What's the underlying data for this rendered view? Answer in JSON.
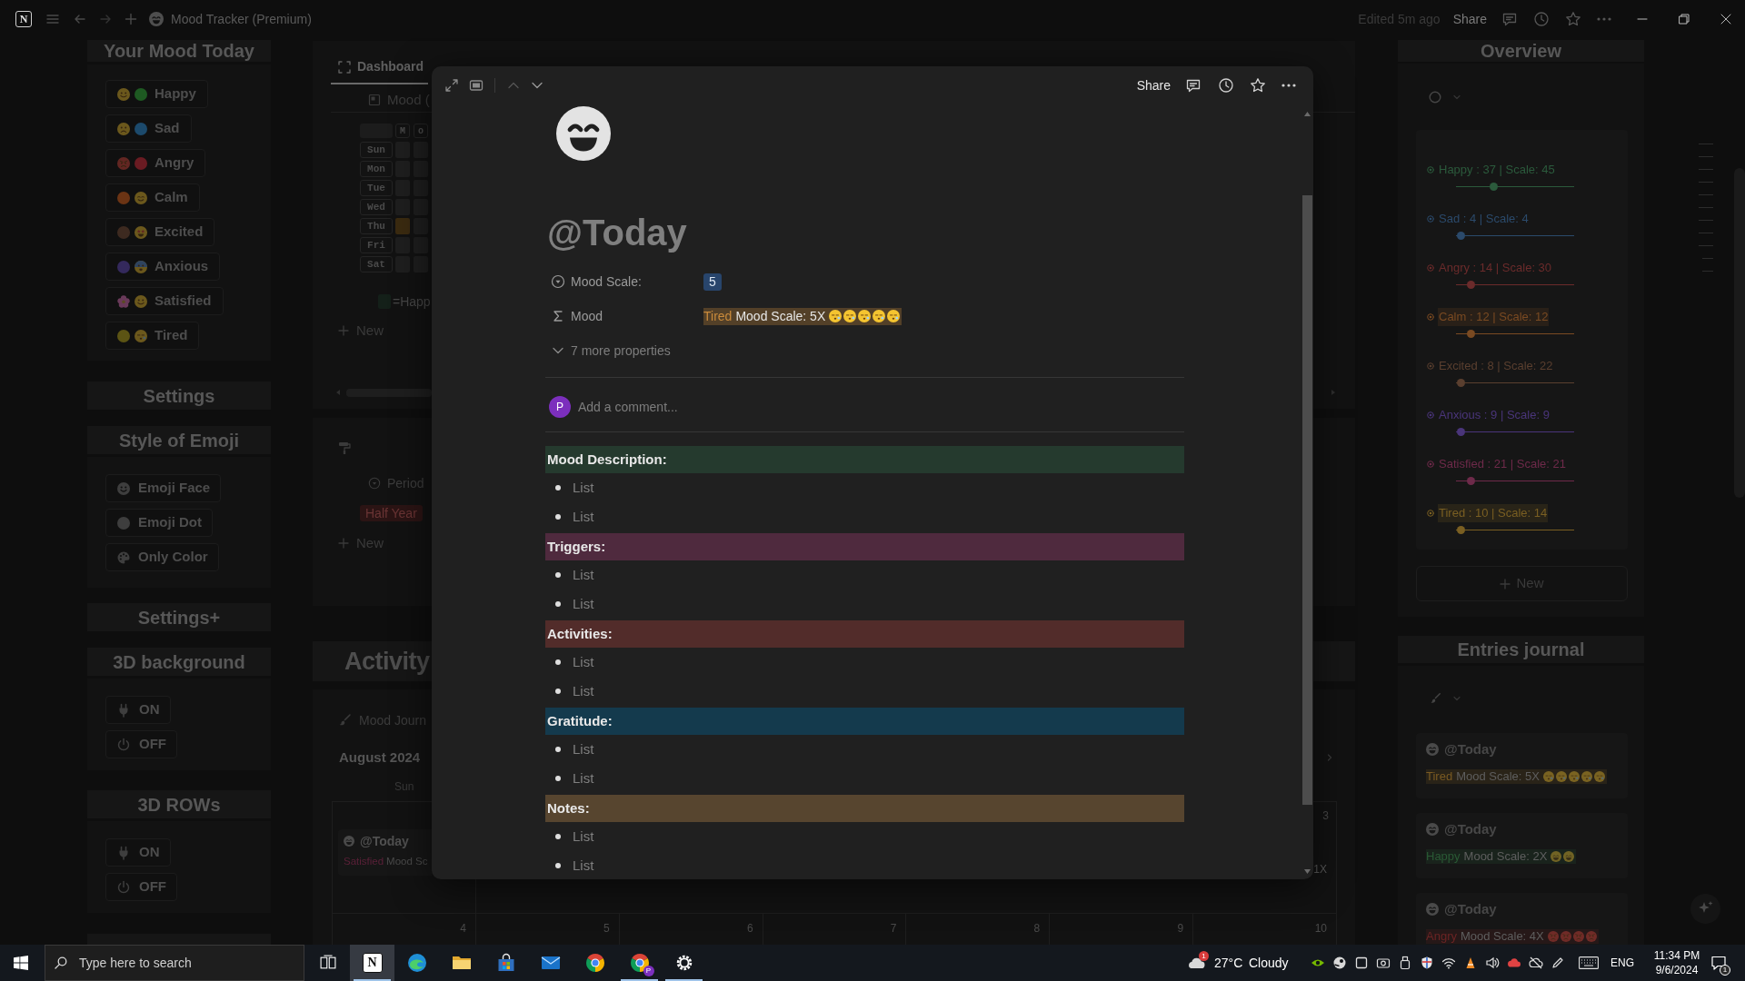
{
  "title_bar": {
    "logo": "N",
    "title": "Mood Tracker (Premium)",
    "edited": "Edited 5m ago",
    "share": "Share"
  },
  "left_panel": {
    "mood_title": "Your Mood Today",
    "moods": [
      {
        "label": "Happy",
        "icons": [
          {
            "kind": "smile"
          },
          {
            "kind": "dot",
            "color": "#1e5a22"
          }
        ]
      },
      {
        "label": "Sad",
        "icons": [
          {
            "kind": "frown"
          },
          {
            "kind": "dot",
            "color": "#1c4a6c"
          }
        ]
      },
      {
        "label": "Angry",
        "icons": [
          {
            "kind": "angry"
          },
          {
            "kind": "dot",
            "color": "#6a1b22"
          }
        ]
      },
      {
        "label": "Calm",
        "icons": [
          {
            "kind": "dot",
            "color": "#6b3414"
          },
          {
            "kind": "relieved"
          }
        ]
      },
      {
        "label": "Excited",
        "icons": [
          {
            "kind": "dot",
            "color": "#3d2a20"
          },
          {
            "kind": "starstruck"
          }
        ]
      },
      {
        "label": "Anxious",
        "icons": [
          {
            "kind": "dot",
            "color": "#34295c"
          },
          {
            "kind": "anxious"
          }
        ]
      },
      {
        "label": "Satisfied",
        "icons": [
          {
            "kind": "flower",
            "color": "#6a3a5a"
          },
          {
            "kind": "smile"
          }
        ]
      },
      {
        "label": "Tired",
        "icons": [
          {
            "kind": "dot",
            "color": "#5c5414"
          },
          {
            "kind": "sleepy"
          }
        ]
      }
    ],
    "settings_title": "Settings",
    "emoji_style_title": "Style of Emoji",
    "emoji_styles": [
      {
        "label": "Emoji Face",
        "kind": "face"
      },
      {
        "label": "Emoji Dot",
        "kind": "dot"
      },
      {
        "label": "Only Color",
        "kind": "palette"
      }
    ],
    "settings_plus_title": "Settings+",
    "toggle_groups": [
      {
        "title": "3D background",
        "buttons": [
          {
            "label": "ON",
            "kind": "plug"
          },
          {
            "label": "OFF",
            "kind": "power"
          }
        ]
      },
      {
        "title": "3D ROWs",
        "buttons": [
          {
            "label": "ON",
            "kind": "plug"
          },
          {
            "label": "OFF",
            "kind": "power"
          }
        ]
      }
    ]
  },
  "dashboard": {
    "tabs": [
      {
        "label": "Dashboard",
        "selected": true
      }
    ],
    "view": "Mood (",
    "heatmap": {
      "columns": [
        "M",
        "o"
      ],
      "days": [
        {
          "label": "Sun",
          "cells": [
            {
              "filled": false
            },
            {
              "filled": false
            }
          ]
        },
        {
          "label": "Mon",
          "cells": [
            {
              "filled": false
            },
            {
              "filled": false
            }
          ]
        },
        {
          "label": "Tue",
          "cells": [
            {
              "filled": false
            },
            {
              "filled": false
            }
          ]
        },
        {
          "label": "Wed",
          "cells": [
            {
              "filled": false
            },
            {
              "filled": false
            }
          ]
        },
        {
          "label": "Thu",
          "cells": [
            {
              "filled": true
            },
            {
              "filled": false
            }
          ]
        },
        {
          "label": "Fri",
          "cells": [
            {
              "filled": false
            },
            {
              "filled": false
            }
          ]
        },
        {
          "label": "Sat",
          "cells": [
            {
              "filled": false
            },
            {
              "filled": false
            }
          ]
        }
      ]
    },
    "legend": "=Happ",
    "new_label": "New"
  },
  "period": {
    "label": "Period",
    "tag": "Half Year",
    "new_label": "New"
  },
  "activity": {
    "title": "Activity",
    "view": "Mood Journ",
    "month": "August 2024",
    "weekday": "Sun",
    "week_1": {
      "sun_entry": {
        "title": "@Today",
        "mood": "Satisfied",
        "color": "#5a2038",
        "text": "Mood Sc"
      },
      "sat_date": "3",
      "sat_entry_text": "1X"
    },
    "week_2_dates": [
      "4",
      "5",
      "6",
      "7",
      "8",
      "9",
      "10"
    ]
  },
  "peek": {
    "share": "Share",
    "title": "@Today",
    "properties": [
      {
        "kind": "select",
        "label": "Mood Scale:",
        "value": "5"
      },
      {
        "kind": "formula",
        "label": "Mood",
        "mood": "Tired",
        "text": "Mood Scale: 5X",
        "faces": [
          {
            "kind": "sleepy"
          },
          {
            "kind": "sleepy"
          },
          {
            "kind": "sleepy"
          },
          {
            "kind": "sleepy"
          },
          {
            "kind": "sleepy"
          }
        ]
      }
    ],
    "more_properties": "7 more properties",
    "comment": {
      "avatar": "P",
      "placeholder": "Add a comment..."
    },
    "sections": [
      {
        "heading": "Mood Description:",
        "color": "#253a2e",
        "items": [
          "List",
          "List"
        ]
      },
      {
        "heading": "Triggers:",
        "color": "#4f2a3e",
        "items": [
          "List",
          "List"
        ]
      },
      {
        "heading": "Activities:",
        "color": "#522c2a",
        "items": [
          "List",
          "List"
        ]
      },
      {
        "heading": "Gratitude:",
        "color": "#143a4d",
        "items": [
          "List",
          "List"
        ]
      },
      {
        "heading": "Notes:",
        "color": "#57452f",
        "items": [
          "List",
          "List"
        ]
      }
    ]
  },
  "overview": {
    "title": "Overview",
    "items": [
      {
        "label": "Happy : 37 | Scale: 45",
        "color": "#2b5a3c",
        "highlighted": false,
        "level": 0.32
      },
      {
        "label": "Sad : 4 | Scale: 4",
        "color": "#2b4a6b",
        "highlighted": false,
        "level": 0.04
      },
      {
        "label": "Angry : 14 | Scale: 30",
        "color": "#6b2b2b",
        "highlighted": false,
        "level": 0.13
      },
      {
        "label": "Calm : 12 | Scale: 12",
        "color": "#7a4a22",
        "highlighted": true,
        "level": 0.13
      },
      {
        "label": "Excited : 8 | Scale: 22",
        "color": "#5a3f2f",
        "highlighted": false,
        "level": 0.04
      },
      {
        "label": "Anxious : 9 | Scale: 9",
        "color": "#4a357a",
        "highlighted": false,
        "level": 0.04
      },
      {
        "label": "Satisfied : 21 | Scale: 21",
        "color": "#6e2a4a",
        "highlighted": false,
        "level": 0.13
      },
      {
        "label": "Tired : 10 | Scale: 14",
        "color": "#7a5f22",
        "highlighted": true,
        "level": 0.04
      }
    ],
    "new_label": "New"
  },
  "entries_journal": {
    "title": "Entries journal",
    "entries": [
      {
        "title": "@Today",
        "mood": "Tired",
        "color": "#7a5a22",
        "text": "Mood Scale: 5X",
        "faces": [
          {
            "kind": "sleepy"
          },
          {
            "kind": "sleepy"
          },
          {
            "kind": "sleepy"
          },
          {
            "kind": "sleepy"
          },
          {
            "kind": "sleepy"
          }
        ]
      },
      {
        "title": "@Today",
        "mood": "Happy",
        "color": "#2a5a35",
        "text": "Mood Scale: 2X",
        "faces": [
          {
            "kind": "grin"
          },
          {
            "kind": "grin"
          }
        ]
      },
      {
        "title": "@Today",
        "mood": "Angry",
        "color": "#6b2424",
        "text": "Mood Scale: 4X",
        "faces": [
          {
            "kind": "angry"
          },
          {
            "kind": "angry"
          },
          {
            "kind": "angry"
          },
          {
            "kind": "angry"
          }
        ]
      }
    ]
  },
  "taskbar": {
    "search": {
      "placeholder": "Type here to search"
    },
    "apps": [
      {
        "kind": "task-view",
        "active": false,
        "running": false
      },
      {
        "kind": "n-tile",
        "label": "N",
        "active": true,
        "running": true
      },
      {
        "kind": "swirl",
        "active": false,
        "running": false
      },
      {
        "kind": "folder",
        "active": false,
        "running": false
      },
      {
        "kind": "bag",
        "active": false,
        "running": false
      },
      {
        "kind": "envelope",
        "active": false,
        "running": false
      },
      {
        "kind": "segmented-circle",
        "active": false,
        "running": false
      },
      {
        "kind": "segmented-circle-badge",
        "label": "P",
        "active": false,
        "running": true
      },
      {
        "kind": "gear",
        "active": false,
        "running": true
      }
    ],
    "weather": {
      "badge": "1",
      "temperature": "27°C",
      "condition": "Cloudy"
    },
    "language": "ENG",
    "time": "11:34 PM",
    "date": "9/6/2024",
    "notification_count": "1"
  }
}
